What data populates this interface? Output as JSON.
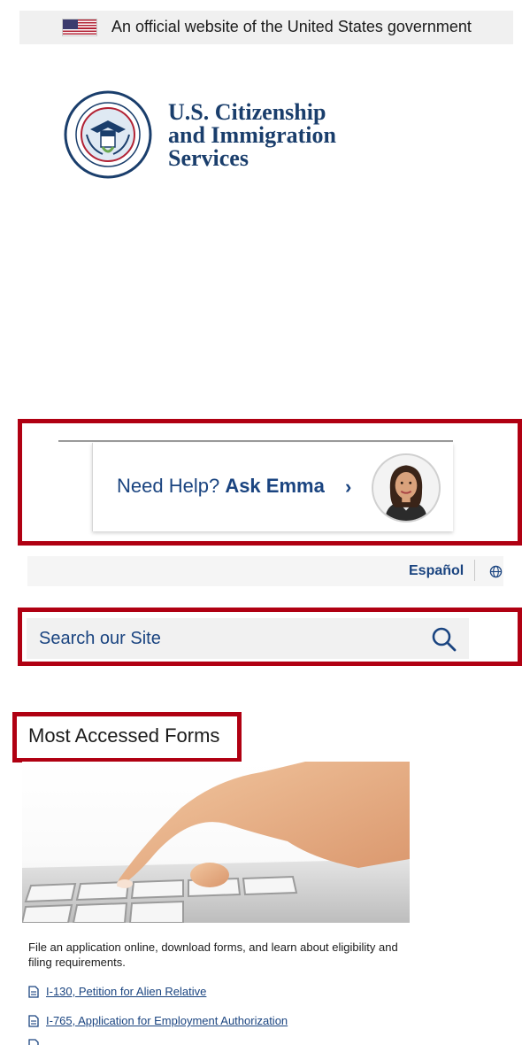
{
  "gov_banner": {
    "text": "An official website of the United States government"
  },
  "logo": {
    "line1": "U.S. Citizenship",
    "line2": "and Immigration",
    "line3": "Services"
  },
  "ask_emma": {
    "prefix": "Need Help?",
    "emphasis": "Ask Emma",
    "chevron": "›"
  },
  "language": {
    "label": "Español",
    "icon": "globe-icon"
  },
  "search": {
    "placeholder": "Search our Site",
    "icon": "search-icon"
  },
  "most_accessed_forms": {
    "title": "Most Accessed Forms",
    "description": "File an application online, download forms, and learn about eligibility and filing requirements.",
    "links": [
      {
        "label": "I-130, Petition for Alien Relative",
        "icon": "document-icon"
      },
      {
        "label": "I-765, Application for Employment Authorization",
        "icon": "document-icon"
      }
    ]
  },
  "colors": {
    "brand": "#1a4480",
    "highlight": "#b00012",
    "banner_bg": "#f0f0f0"
  }
}
